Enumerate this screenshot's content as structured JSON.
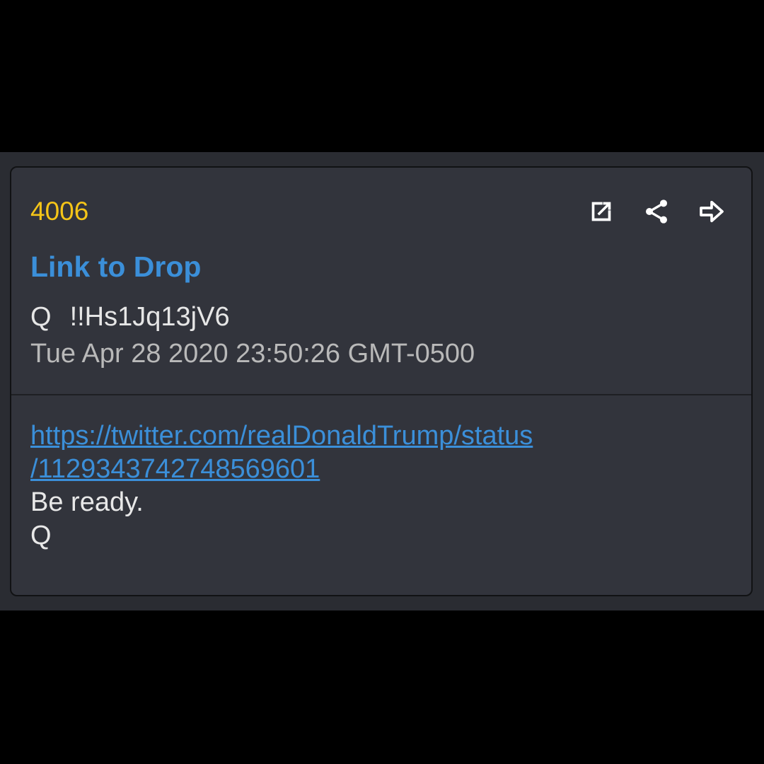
{
  "drop": {
    "number": "4006",
    "link_label": "Link to Drop",
    "author_name": "Q",
    "tripcode": "!!Hs1Jq13jV6",
    "timestamp": "Tue Apr 28 2020 23:50:26 GMT-0500"
  },
  "actions": [
    {
      "name": "open-external-icon"
    },
    {
      "name": "share-icon"
    },
    {
      "name": "forward-arrow-icon"
    }
  ],
  "body": {
    "link_line1": "https://twitter.com/realDonaldTrump/status",
    "link_line2": "/1129343742748569601",
    "text_line1": "Be ready.",
    "text_line2": "Q"
  },
  "colors": {
    "number": "#f5c518",
    "link": "#3b8fd9",
    "card_bg": "#32343c",
    "page_bg": "#000000"
  }
}
